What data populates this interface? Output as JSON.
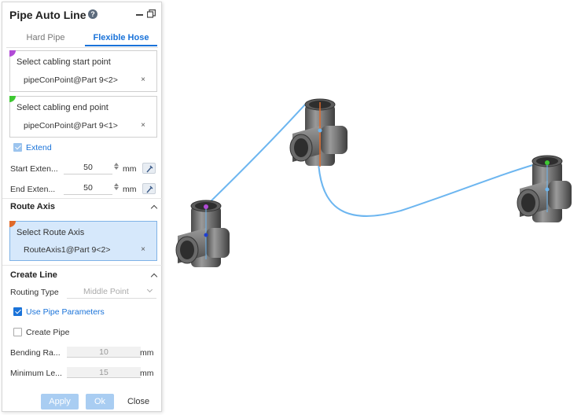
{
  "panel": {
    "title": "Pipe Auto Line",
    "help_icon": "help-icon",
    "tabs": [
      {
        "label": "Hard Pipe",
        "active": false
      },
      {
        "label": "Flexible Hose",
        "active": true
      }
    ],
    "start_point": {
      "label": "Select cabling start point",
      "value": "pipeConPoint@Part 9<2>",
      "color": "#b14bd6",
      "clear": "×"
    },
    "end_point": {
      "label": "Select cabling end point",
      "value": "pipeConPoint@Part 9<1>",
      "color": "#3ec832",
      "clear": "×"
    },
    "extend": {
      "label": "Extend",
      "checked": true
    },
    "start_extension": {
      "label": "Start Exten...",
      "value": "50",
      "unit": "mm"
    },
    "end_extension": {
      "label": "End Exten...",
      "value": "50",
      "unit": "mm"
    },
    "route_axis": {
      "section_title": "Route Axis",
      "label": "Select Route Axis",
      "value": "RouteAxis1@Part 9<2>",
      "color": "#e06a2a",
      "clear": "×"
    },
    "create_line": {
      "section_title": "Create Line",
      "routing_type_label": "Routing Type",
      "routing_type_value": "Middle Point",
      "use_pipe_params": {
        "label": "Use Pipe Parameters",
        "checked": true
      },
      "create_pipe": {
        "label": "Create Pipe",
        "checked": false
      },
      "bending_radius": {
        "label": "Bending Ra...",
        "value": "10",
        "unit": "mm"
      },
      "minimum_length": {
        "label": "Minimum Le...",
        "value": "15",
        "unit": "mm"
      }
    },
    "buttons": {
      "apply": "Apply",
      "ok": "Ok",
      "close": "Close"
    }
  },
  "colors": {
    "accent": "#1a73d9",
    "route_line": "#6db6f0",
    "pipe_body": "#6f6f6f"
  }
}
